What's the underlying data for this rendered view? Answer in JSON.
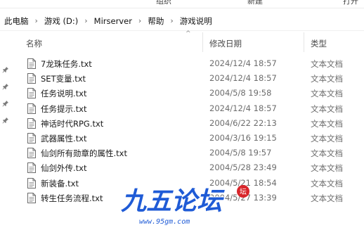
{
  "ribbon": {
    "items": [
      "组织",
      "新建",
      "打开"
    ]
  },
  "breadcrumb": {
    "items": [
      "此电脑",
      "游戏 (D:)",
      "Mirserver",
      "帮助",
      "游戏说明"
    ],
    "separator": "›"
  },
  "columns": {
    "name": "名称",
    "modified": "修改日期",
    "type": "类型"
  },
  "files": [
    {
      "name": "7龙珠任务.txt",
      "modified": "2024/12/4 18:57",
      "type": "文本文档"
    },
    {
      "name": "SET变量.txt",
      "modified": "2024/12/4 18:57",
      "type": "文本文档"
    },
    {
      "name": "任务说明.txt",
      "modified": "2004/5/8 19:58",
      "type": "文本文档"
    },
    {
      "name": "任务提示.txt",
      "modified": "2024/12/4 18:57",
      "type": "文本文档"
    },
    {
      "name": "神话时代RPG.txt",
      "modified": "2004/6/22 22:13",
      "type": "文本文档"
    },
    {
      "name": "武器属性.txt",
      "modified": "2004/3/16 19:15",
      "type": "文本文档"
    },
    {
      "name": "仙剑所有勋章的属性.txt",
      "modified": "2004/5/8 19:57",
      "type": "文本文档"
    },
    {
      "name": "仙剑外传.txt",
      "modified": "2004/5/28 23:49",
      "type": "文本文档"
    },
    {
      "name": "新装备.txt",
      "modified": "2004/5/21 18:54",
      "type": "文本文档"
    },
    {
      "name": "转生任务流程.txt",
      "modified": "2004/5/27 13:39",
      "type": "文本文档"
    }
  ],
  "watermark": {
    "logo_text": "九五论坛",
    "url": "www.95gm.com"
  },
  "colors": {
    "watermark_blue": "#1f5bd6",
    "watermark_red": "#d8262b"
  }
}
